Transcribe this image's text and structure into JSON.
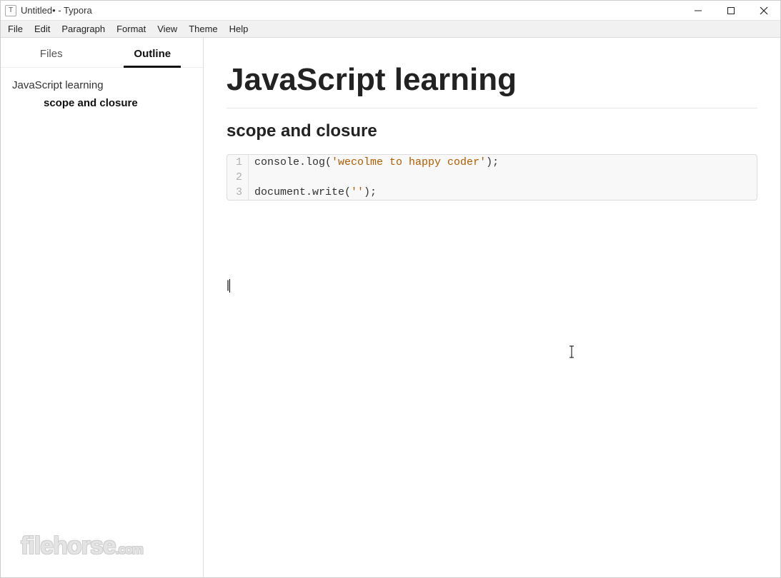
{
  "window": {
    "title": "Untitled• - Typora",
    "icon_letter": "T"
  },
  "menubar": [
    "File",
    "Edit",
    "Paragraph",
    "Format",
    "View",
    "Theme",
    "Help"
  ],
  "sidebar": {
    "tabs": {
      "files": "Files",
      "outline": "Outline",
      "active": "outline"
    },
    "outline": {
      "h1": "JavaScript learning",
      "h2": "scope and closure"
    }
  },
  "document": {
    "h1": "JavaScript learning",
    "h2": "scope and closure",
    "code": {
      "lines": [
        {
          "n": "1",
          "plain_before": "console.log(",
          "string": "'wecolme to happy coder'",
          "plain_after": ");"
        },
        {
          "n": "2",
          "plain_before": "",
          "string": "",
          "plain_after": ""
        },
        {
          "n": "3",
          "plain_before": "document.write(",
          "string": "''",
          "plain_after": ");"
        }
      ]
    },
    "caret_text": "|"
  },
  "watermark": {
    "main": "filehorse",
    "tld": ".com"
  }
}
